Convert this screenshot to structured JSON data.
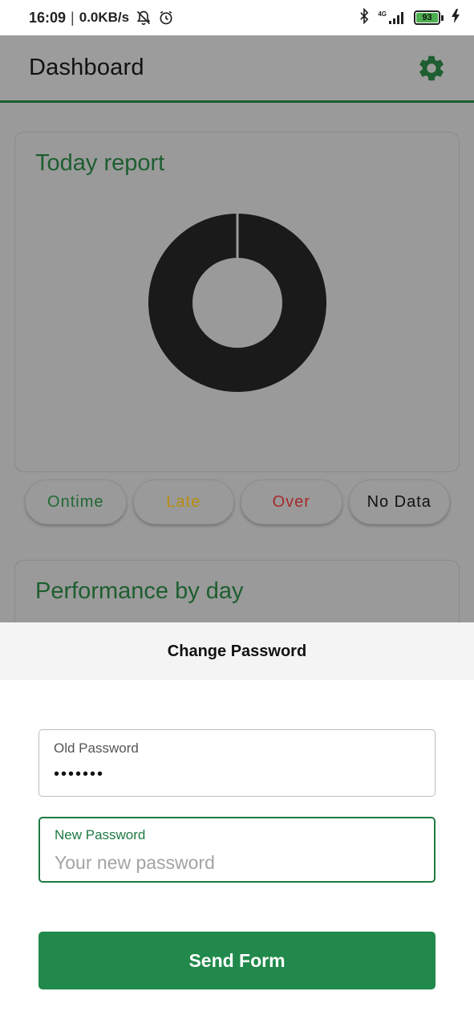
{
  "status_bar": {
    "time": "16:09",
    "separator": "|",
    "net_speed": "0.0KB/s",
    "network_type": "4G",
    "battery": "93",
    "icons": [
      "notifications-off-icon",
      "alarm-icon",
      "bluetooth-icon",
      "signal-icon",
      "battery-icon",
      "charging-icon"
    ]
  },
  "appbar": {
    "title": "Dashboard",
    "settings_icon": "gear-icon",
    "accent_color": "#1e5e30"
  },
  "report_card": {
    "title": "Today report",
    "donut_color": "#1a1a1a"
  },
  "legend": [
    {
      "label": "Ontime",
      "color": "#1e6a33"
    },
    {
      "label": "Late",
      "color": "#b98c10"
    },
    {
      "label": "Over",
      "color": "#a52a2a"
    },
    {
      "label": "No Data",
      "color": "#111111"
    }
  ],
  "performance_card": {
    "title": "Performance by day"
  },
  "sheet": {
    "title": "Change Password",
    "old_password": {
      "label": "Old Password",
      "value": "•••••••"
    },
    "new_password": {
      "label": "New Password",
      "placeholder": "Your new password"
    },
    "submit_label": "Send Form",
    "button_color": "#21894b"
  }
}
